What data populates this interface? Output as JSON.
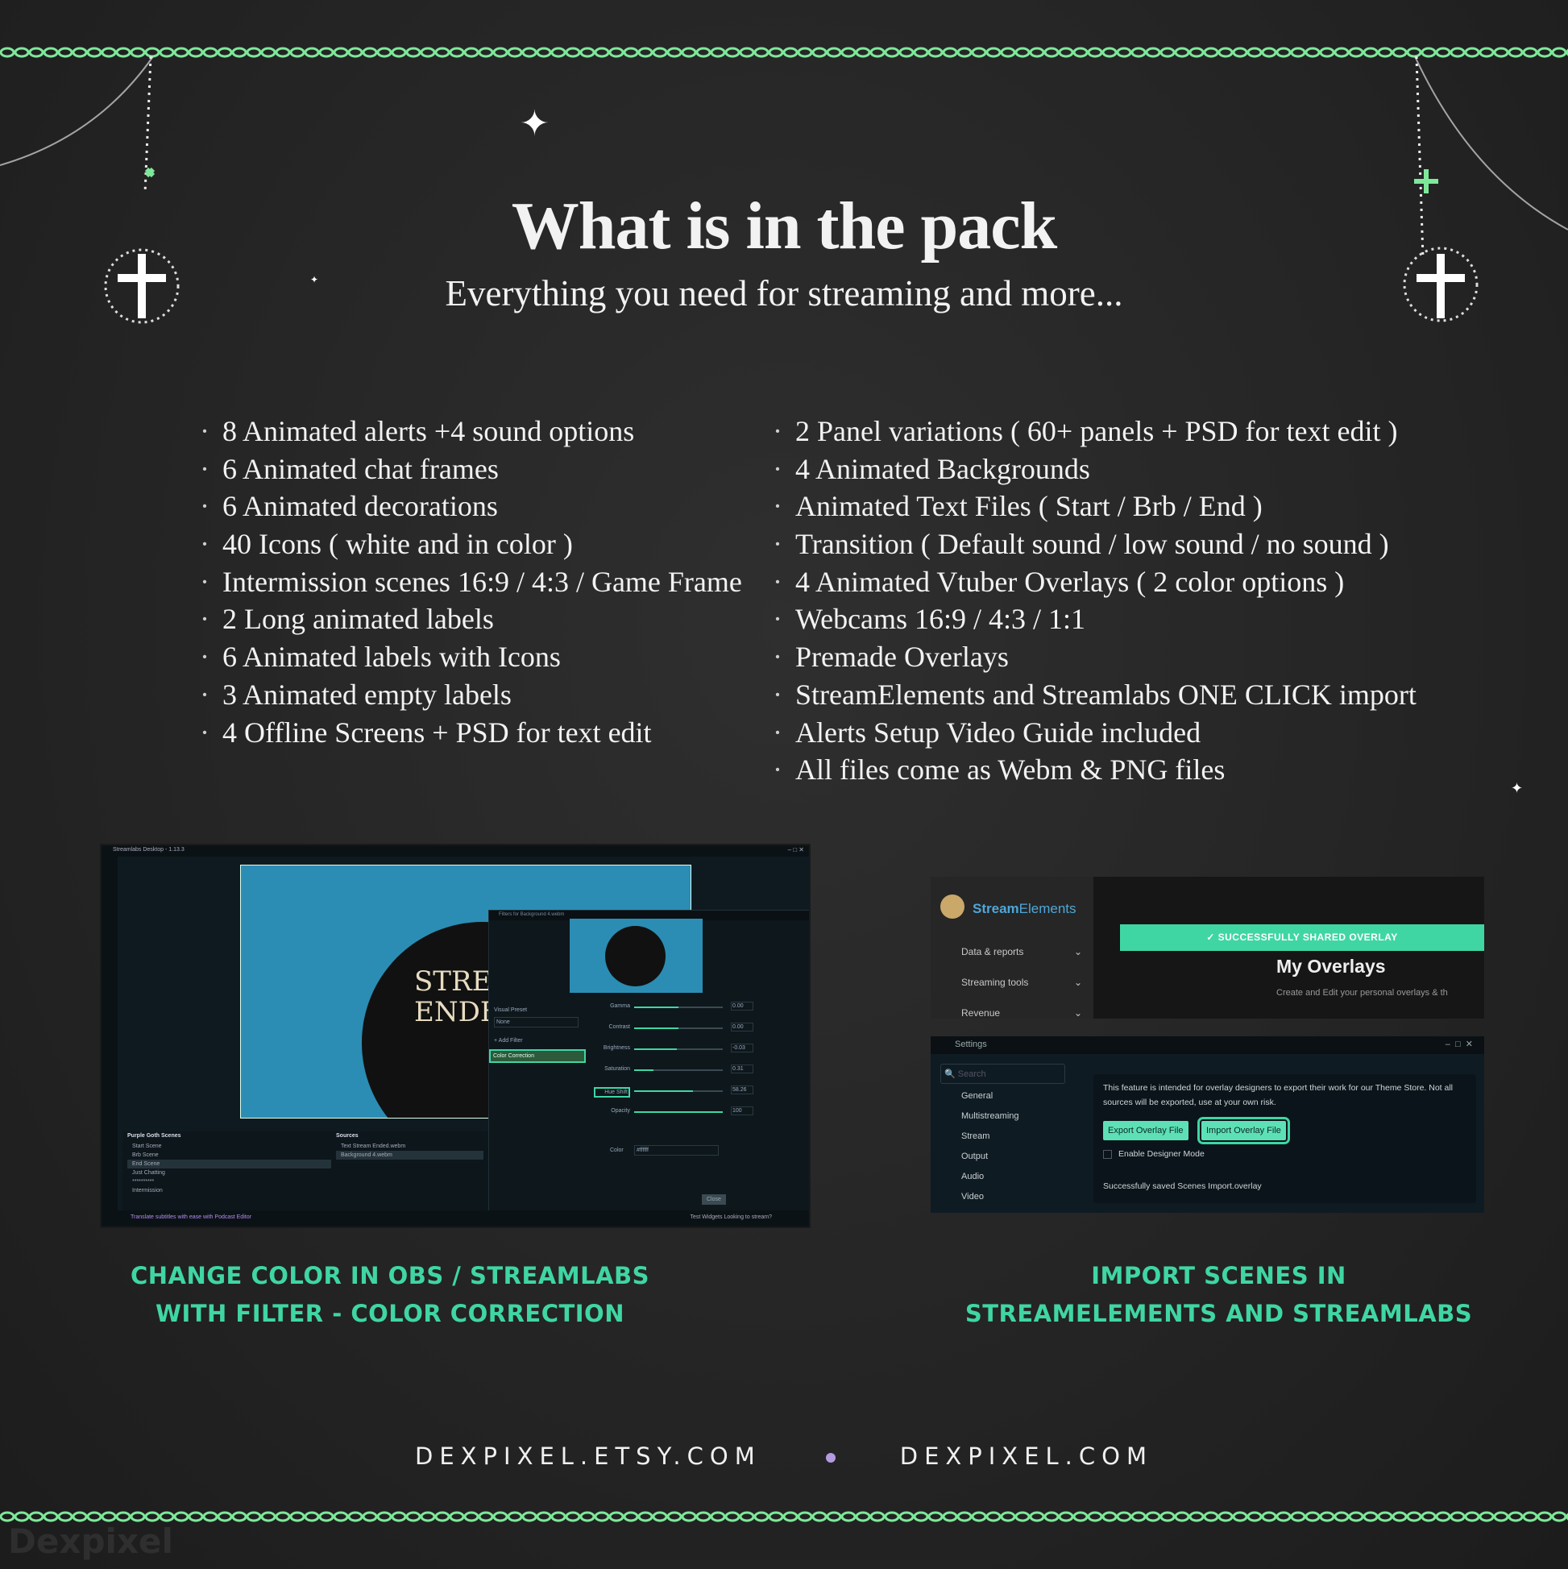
{
  "title": "What is in the pack",
  "subtitle": "Everything you need for streaming and more...",
  "features_left": [
    "8 Animated alerts +4 sound options",
    "6 Animated chat frames",
    "6 Animated decorations",
    "40 Icons ( white and in color )",
    "Intermission scenes 16:9 / 4:3 / Game Frame",
    "2 Long animated labels",
    "6 Animated labels with Icons",
    "3 Animated empty labels",
    "4 Offline Screens + PSD for text edit"
  ],
  "features_right": [
    "2 Panel variations ( 60+ panels + PSD for text edit )",
    "4 Animated Backgrounds",
    "Animated Text Files ( Start / Brb / End )",
    "Transition ( Default sound / low sound / no sound )",
    "4 Animated Vtuber Overlays ( 2 color options )",
    "Webcams 16:9 / 4:3 / 1:1",
    "Premade Overlays",
    "StreamElements and Streamlabs ONE CLICK import",
    "Alerts Setup Video Guide included",
    "All files come as Webm & PNG files"
  ],
  "obs_screenshot": {
    "window_title": "Streamlabs Desktop - 1.13.3",
    "canvas_text": "STREAM ENDED",
    "filter_window_title": "Filters for Background 4.webm",
    "visual_preset_label": "Visual Preset",
    "visual_preset_value": "None",
    "add_filter": "+ Add Filter",
    "active_filter": "Color Correction",
    "sliders": [
      {
        "label": "Gamma",
        "value": "0.00",
        "fill": 0.5
      },
      {
        "label": "Contrast",
        "value": "0.00",
        "fill": 0.5
      },
      {
        "label": "Brightness",
        "value": "-0.03",
        "fill": 0.48
      },
      {
        "label": "Saturation",
        "value": "0.31",
        "fill": 0.22
      },
      {
        "label": "Hue Shift",
        "value": "58.26",
        "fill": 0.66
      },
      {
        "label": "Opacity",
        "value": "100",
        "fill": 1.0
      }
    ],
    "color_label": "Color",
    "color_value": "#ffffff",
    "close": "Close",
    "scenes_header": "Purple Goth Scenes",
    "scenes": [
      "Start Scene",
      "Brb Scene",
      "End Scene",
      "Just Chatting",
      "**********",
      "Intermission"
    ],
    "sources_header": "Sources",
    "sources": [
      "Text Stream Ended.webm",
      "Background 4.webm"
    ],
    "promo": "Translate subtitles with ease with Podcast Editor",
    "bottom_right": "Test Widgets  Looking to stream?"
  },
  "se_screenshot": {
    "brand": "Stream",
    "brand2": "Elements",
    "nav": [
      "Data & reports",
      "Streaming tools",
      "Revenue"
    ],
    "banner": "✓ SUCCESSFULLY SHARED OVERLAY",
    "heading": "My Overlays",
    "subheading": "Create and Edit your personal overlays & th",
    "settings_title": "Settings",
    "search_placeholder": "Search",
    "settings_nav": [
      "General",
      "Multistreaming",
      "Stream",
      "Output",
      "Audio",
      "Video"
    ],
    "info_text": "This feature is intended for overlay designers to export their work for our Theme Store. Not all sources will be exported, use at your own risk.",
    "export_button": "Export Overlay File",
    "import_button": "Import Overlay File",
    "designer_mode": "Enable Designer Mode",
    "saved_message": "Successfully saved Scenes Import.overlay"
  },
  "caption_left": [
    "CHANGE COLOR IN OBS / STREAMLABS",
    "WITH FILTER - COLOR CORRECTION"
  ],
  "caption_right": [
    "IMPORT SCENES IN",
    "STREAMELEMENTS AND STREAMLABS"
  ],
  "footer": {
    "left": "DEXPIXEL.ETSY.COM",
    "right": "DEXPIXEL.COM"
  },
  "watermark": "Dexpixel",
  "colors": {
    "accent": "#3fd6a4",
    "chain": "#7ee89a",
    "background": "#252525",
    "footer_dot": "#b49be0"
  }
}
